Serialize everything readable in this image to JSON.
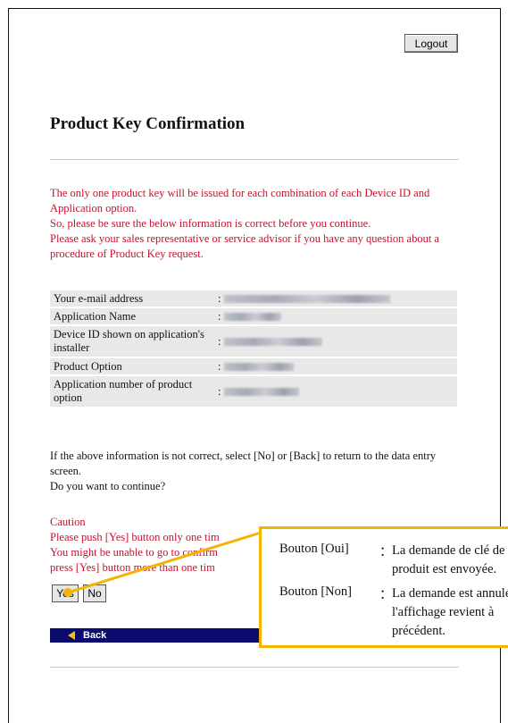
{
  "header": {
    "logout_label": "Logout"
  },
  "page": {
    "title": "Product Key Confirmation"
  },
  "notice": {
    "lines": [
      "The only one product key will be issued for each combination of each Device ID and Application option.",
      "So, please be sure the below information is correct before you continue.",
      "Please ask your sales representative or service advisor if you have any question about a procedure of Product Key request."
    ]
  },
  "info": {
    "rows": [
      {
        "label": "Your e-mail address",
        "sep": ":"
      },
      {
        "label": "Application Name",
        "sep": ":"
      },
      {
        "label": "Device ID shown on application's installer",
        "sep": ":"
      },
      {
        "label": "Product Option",
        "sep": ":"
      },
      {
        "label": "Application number of product option",
        "sep": ":"
      }
    ]
  },
  "question": {
    "line1": "If the above information is not correct, select [No] or [Back] to return to the data entry screen.",
    "line2": "Do you want to continue?"
  },
  "caution": {
    "title": "Caution",
    "line1": "Please push [Yes] button only one tim",
    "line2": "You might be unable to go to confirm",
    "line3": "press [Yes] button more than one tim"
  },
  "buttons": {
    "yes_label": "Yes",
    "no_label": "No",
    "back_label": "Back"
  },
  "callout": {
    "rows": [
      {
        "key": "Bouton [Oui]",
        "sep": "：",
        "line1": "La demande de clé de",
        "line2": "produit est envoyée."
      },
      {
        "key": "Bouton [Non]",
        "sep": "：",
        "line1": "La demande est annulée,",
        "line2": "l'affichage revient à",
        "line3": "précédent."
      }
    ]
  },
  "colors": {
    "accent_red": "#c8102e",
    "callout_border": "#f4b400",
    "back_bar": "#0b0b6e"
  }
}
